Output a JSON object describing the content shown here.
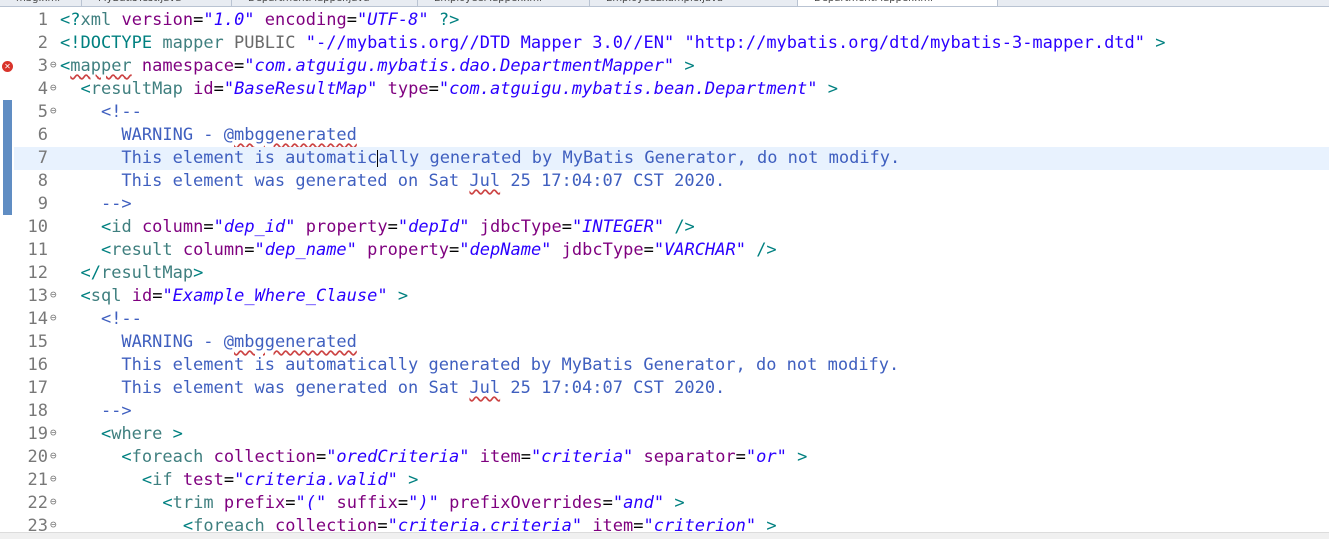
{
  "tabs": [
    {
      "label": "mbg.xml"
    },
    {
      "label": "MyBatisTest.java"
    },
    {
      "label": "DepartmentMapper.java"
    },
    {
      "label": "EmployeeMapper.xml"
    },
    {
      "label": "EmployeeExample.java"
    },
    {
      "label": "DepartmentMapper.xml",
      "active": true
    }
  ],
  "editor": {
    "lines": [
      {
        "n": "1",
        "fold": "",
        "html": "<span class='br'>&lt;?</span><span class='tg'>xml</span> <span class='at'>version</span>=<span class='vl'>\"1.0\"</span> <span class='at'>encoding</span>=<span class='vl'>\"UTF-8\"</span> <span class='br'>?&gt;</span>"
      },
      {
        "n": "2",
        "fold": "",
        "html": "<span class='br'>&lt;!DOCTYPE</span> <span class='tg'>mapper</span> <span class='kw'>PUBLIC</span> <span class='vl' style='font-style:normal'>\"-//mybatis.org//DTD Mapper 3.0//EN\"</span> <span class='vl' style='font-style:normal'>\"http://mybatis.org/dtd/mybatis-3-mapper.dtd\"</span> <span class='br'>&gt;</span>"
      },
      {
        "n": "3",
        "fold": "⊖",
        "html": "<span class='br'>&lt;</span><span class='tg sq'>mapper</span> <span class='at'>namespace</span>=<span class='vl'>\"com.atguigu.mybatis.dao.DepartmentMapper\"</span> <span class='br'>&gt;</span>"
      },
      {
        "n": "4",
        "fold": "⊖",
        "html": "  <span class='br'>&lt;</span><span class='tg'>resultMap</span> <span class='at'>id</span>=<span class='vl'>\"BaseResultMap\"</span> <span class='at'>type</span>=<span class='vl'>\"com.atguigu.mybatis.bean.Department\"</span> <span class='br'>&gt;</span>"
      },
      {
        "n": "5",
        "fold": "⊖",
        "html": "    <span class='cm'>&lt;!--</span>"
      },
      {
        "n": "6",
        "fold": "",
        "html": "<span class='cm'>      WARNING - @<span class='sq'>mbggenerated</span></span>"
      },
      {
        "n": "7",
        "fold": "",
        "current": true,
        "html": "<span class='cm'>      This element is automatic<span class='caret'></span>ally generated by MyBatis Generator, do not modify.</span>"
      },
      {
        "n": "8",
        "fold": "",
        "html": "<span class='cm'>      This element was generated on Sat <span class='sq'>Jul</span> 25 17:04:07 CST 2020.</span>"
      },
      {
        "n": "9",
        "fold": "",
        "html": "<span class='cm'>    --&gt;</span>"
      },
      {
        "n": "10",
        "fold": "",
        "html": "    <span class='br'>&lt;</span><span class='tg'>id</span> <span class='at'>column</span>=<span class='vl'>\"dep_id\"</span> <span class='at'>property</span>=<span class='vl'>\"depId\"</span> <span class='at'>jdbcType</span>=<span class='vl'>\"INTEGER\"</span> <span class='br'>/&gt;</span>"
      },
      {
        "n": "11",
        "fold": "",
        "html": "    <span class='br'>&lt;</span><span class='tg'>result</span> <span class='at'>column</span>=<span class='vl'>\"dep_name\"</span> <span class='at'>property</span>=<span class='vl'>\"depName\"</span> <span class='at'>jdbcType</span>=<span class='vl'>\"VARCHAR\"</span> <span class='br'>/&gt;</span>"
      },
      {
        "n": "12",
        "fold": "",
        "html": "  <span class='br'>&lt;/</span><span class='tg'>resultMap</span><span class='br'>&gt;</span>"
      },
      {
        "n": "13",
        "fold": "⊖",
        "html": "  <span class='br'>&lt;</span><span class='tg'>sql</span> <span class='at'>id</span>=<span class='vl'>\"Example_Where_Clause\"</span> <span class='br'>&gt;</span>"
      },
      {
        "n": "14",
        "fold": "⊖",
        "html": "    <span class='cm'>&lt;!--</span>"
      },
      {
        "n": "15",
        "fold": "",
        "html": "<span class='cm'>      WARNING - @<span class='sq'>mbggenerated</span></span>"
      },
      {
        "n": "16",
        "fold": "",
        "html": "<span class='cm'>      This element is automatically generated by MyBatis Generator, do not modify.</span>"
      },
      {
        "n": "17",
        "fold": "",
        "html": "<span class='cm'>      This element was generated on Sat <span class='sq'>Jul</span> 25 17:04:07 CST 2020.</span>"
      },
      {
        "n": "18",
        "fold": "",
        "html": "<span class='cm'>    --&gt;</span>"
      },
      {
        "n": "19",
        "fold": "⊖",
        "html": "    <span class='br'>&lt;</span><span class='tg'>where</span> <span class='br'>&gt;</span>"
      },
      {
        "n": "20",
        "fold": "⊖",
        "html": "      <span class='br'>&lt;</span><span class='tg'>foreach</span> <span class='at'>collection</span>=<span class='vl'>\"oredCriteria\"</span> <span class='at'>item</span>=<span class='vl'>\"criteria\"</span> <span class='at'>separator</span>=<span class='vl'>\"or\"</span> <span class='br'>&gt;</span>"
      },
      {
        "n": "21",
        "fold": "⊖",
        "html": "        <span class='br'>&lt;</span><span class='tg'>if</span> <span class='at'>test</span>=<span class='vl'>\"criteria.valid\"</span> <span class='br'>&gt;</span>"
      },
      {
        "n": "22",
        "fold": "⊖",
        "html": "          <span class='br'>&lt;</span><span class='tg'>trim</span> <span class='at'>prefix</span>=<span class='vl'>\"(\"</span> <span class='at'>suffix</span>=<span class='vl'>\")\"</span> <span class='at'>prefixOverrides</span>=<span class='vl'>\"and\"</span> <span class='br'>&gt;</span>"
      },
      {
        "n": "23",
        "fold": "⊖",
        "html": "            <span class='br'>&lt;</span><span class='tg'>foreach</span> <span class='at'>collection</span>=<span class='vl'>\"criteria.criteria\"</span> <span class='at'>item</span>=<span class='vl'>\"criterion\"</span> <span class='br'>&gt;</span>"
      }
    ]
  },
  "markers": {
    "error_line": "3",
    "change_ranges": [
      [
        "5",
        "9"
      ]
    ]
  },
  "colors": {
    "tag": "#3f7f7f",
    "attribute": "#7f007f",
    "value": "#2a00ff",
    "comment": "#3f5fbf",
    "current_line": "#e8f2fe",
    "error": "#d9342b"
  }
}
